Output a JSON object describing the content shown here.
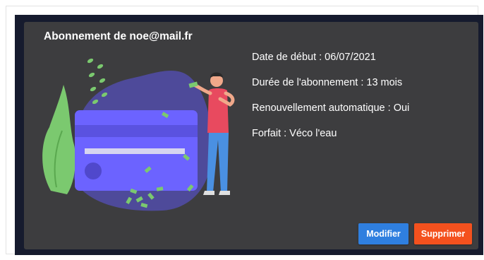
{
  "card": {
    "title": "Abonnement de noe@mail.fr",
    "details": [
      "Date de début : 06/07/2021",
      "Durée de l'abonnement : 13 mois",
      "Renouvellement automatique : Oui",
      "Forfait : Véco l'eau"
    ],
    "illustration": "credit-card-payment-illustration"
  },
  "actions": {
    "edit_label": "Modifier",
    "delete_label": "Supprimer"
  },
  "colors": {
    "card_background": "#3d3d3f",
    "outer_background": "#161b2e",
    "edit_button": "#2f7fdf",
    "delete_button": "#f4511e",
    "card_illustration": "#6c63ff",
    "blob": "#4e4a9a",
    "leaves": "#7bc96f"
  }
}
